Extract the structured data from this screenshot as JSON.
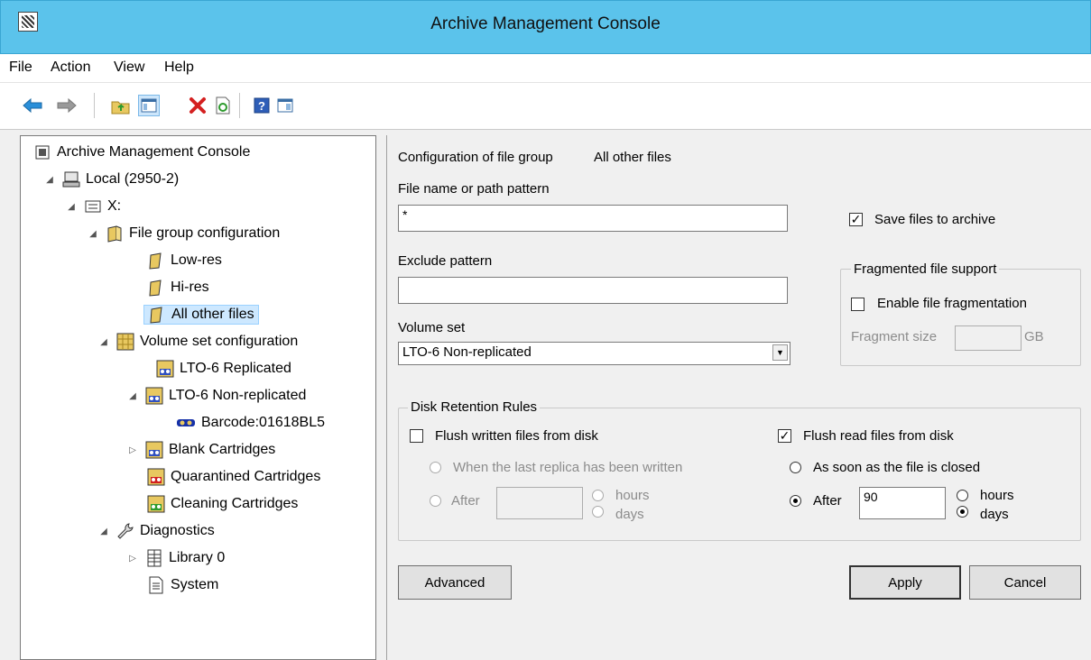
{
  "window": {
    "title": "Archive Management Console"
  },
  "menu": {
    "file": "File",
    "action": "Action",
    "view": "View",
    "help": "Help"
  },
  "toolbar": [
    "back-arrow-icon",
    "forward-arrow-icon",
    "up-folder-icon",
    "show-hide-tree-icon",
    "delete-icon",
    "refresh-icon",
    "help-icon",
    "properties-icon"
  ],
  "tree": {
    "root": "Archive Management Console",
    "local": "Local (2950-2)",
    "drive": "X:",
    "file_group_configuration": "File group configuration",
    "low_res": "Low-res",
    "hi_res": "Hi-res",
    "all_other_files": "All other files",
    "volume_set_configuration": "Volume set configuration",
    "lto6_replicated": "LTO-6 Replicated",
    "lto6_non_replicated": "LTO-6 Non-replicated",
    "barcode": "Barcode:01618BL5",
    "blank_cartridges": "Blank Cartridges",
    "quarantined_cartridges": "Quarantined Cartridges",
    "cleaning_cartridges": "Cleaning Cartridges",
    "diagnostics": "Diagnostics",
    "library0": "Library 0",
    "system": "System"
  },
  "config": {
    "header_label": "Configuration of file group",
    "header_value": "All other files",
    "file_pattern_label": "File name or path pattern",
    "file_pattern_value": "*",
    "exclude_label": "Exclude pattern",
    "exclude_value": "",
    "volume_set_label": "Volume set",
    "volume_set_value": "LTO-6 Non-replicated",
    "save_files_label": "Save files to archive",
    "save_files_checked": true,
    "fragment_group_title": "Fragmented file support",
    "enable_fragment_label": "Enable file fragmentation",
    "enable_fragment_checked": false,
    "fragment_size_label": "Fragment size",
    "fragment_size_value": "",
    "fragment_unit": "GB"
  },
  "retention": {
    "title": "Disk Retention Rules",
    "flush_written_label": "Flush written files from disk",
    "flush_written_checked": false,
    "when_last_replica_label": "When the last replica has been written",
    "after_label_left": "After",
    "after_value_left": "",
    "hours_left": "hours",
    "days_left": "days",
    "flush_read_label": "Flush read files from disk",
    "flush_read_checked": true,
    "as_soon_label": "As soon as the file is closed",
    "after_label_right": "After",
    "after_value_right": "90",
    "hours_right": "hours",
    "days_right": "days",
    "unit_selected_right": "days"
  },
  "buttons": {
    "advanced": "Advanced",
    "apply": "Apply",
    "cancel": "Cancel"
  }
}
